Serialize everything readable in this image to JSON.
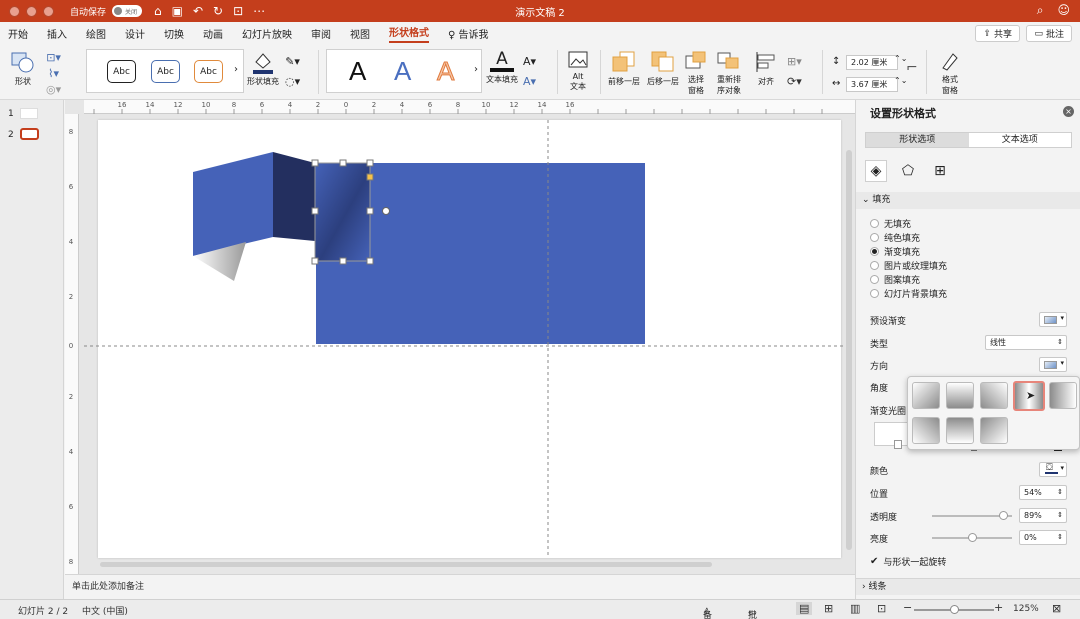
{
  "window": {
    "autosave_label": "自动保存",
    "autosave_state": "关闭",
    "doc_title": "演示文稿 2"
  },
  "tabs": [
    {
      "label": "开始"
    },
    {
      "label": "插入"
    },
    {
      "label": "绘图"
    },
    {
      "label": "设计"
    },
    {
      "label": "切换"
    },
    {
      "label": "动画"
    },
    {
      "label": "幻灯片放映"
    },
    {
      "label": "审阅"
    },
    {
      "label": "视图"
    },
    {
      "label": "形状格式",
      "active": true
    },
    {
      "label": "告诉我"
    }
  ],
  "header": {
    "share_label": "共享",
    "comment_label": "批注"
  },
  "ribbon": {
    "shape_label": "形状",
    "style_samples": [
      "Abc",
      "Abc",
      "Abc"
    ],
    "shape_fill_label": "形状填充",
    "wordart_letters": [
      "A",
      "A",
      "A"
    ],
    "text_fill_label": "文本填充",
    "alt_text_label1": "Alt",
    "alt_text_label2": "文本",
    "bring_forward_label": "前移一层",
    "send_backward_label": "后移一层",
    "selection_pane_label1": "选择",
    "selection_pane_label2": "窗格",
    "reorder_label1": "重新排",
    "reorder_label2": "序对象",
    "align_label": "对齐",
    "height_value": "2.02 厘米",
    "width_value": "3.67 厘米",
    "format_pane_label1": "格式",
    "format_pane_label2": "窗格"
  },
  "thumbnails": [
    {
      "num": "1"
    },
    {
      "num": "2"
    }
  ],
  "notes_placeholder": "单击此处添加备注",
  "ruler": {
    "h_ticks": [
      "16",
      "14",
      "12",
      "10",
      "8",
      "6",
      "4",
      "2",
      "0",
      "2",
      "4",
      "6",
      "8",
      "10",
      "12",
      "14",
      "16"
    ],
    "v_ticks": [
      "8",
      "6",
      "4",
      "2",
      "0",
      "2",
      "4",
      "6",
      "8"
    ]
  },
  "pane": {
    "title": "设置形状格式",
    "tab_shape": "形状选项",
    "tab_text": "文本选项",
    "fill_section": "填充",
    "fill_options": [
      {
        "label": "无填充",
        "selected": false
      },
      {
        "label": "纯色填充",
        "selected": false
      },
      {
        "label": "渐变填充",
        "selected": true
      },
      {
        "label": "图片或纹理填充",
        "selected": false
      },
      {
        "label": "图案填充",
        "selected": false
      },
      {
        "label": "幻灯片背景填充",
        "selected": false
      }
    ],
    "preset_label": "预设渐变",
    "type_label": "类型",
    "type_value": "线性",
    "direction_label": "方向",
    "angle_label": "角度",
    "gradient_stops_label": "渐变光圈",
    "color_label": "颜色",
    "position_label": "位置",
    "position_value": "54%",
    "transparency_label": "透明度",
    "transparency_value": "89%",
    "transparency_level": 0.89,
    "brightness_label": "亮度",
    "brightness_value": "0%",
    "brightness_level": 0.5,
    "rotate_label": "与形状一起旋转",
    "rotate_checked": true,
    "line_section": "线条"
  },
  "status": {
    "slide_info": "幻灯片 2 / 2",
    "language": "中文 (中国)",
    "notes_label": "备注",
    "comments_label": "批注",
    "zoom": "125%"
  },
  "colors": {
    "accent": "#c43e1c",
    "shape_blue": "#4562b8",
    "shape_dark": "#232f5f"
  }
}
